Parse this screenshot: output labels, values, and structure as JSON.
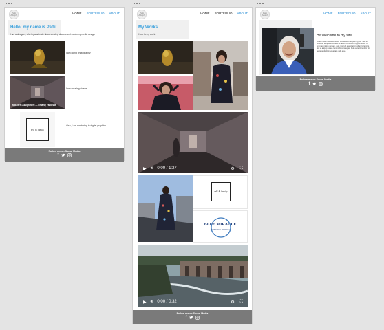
{
  "brand": {
    "logo_text": "Patti Adolph"
  },
  "nav": {
    "home": "HOME",
    "portfolio": "PORTFOLIO",
    "about": "ABOUT"
  },
  "footer": {
    "follow": "Follow me on Social Media"
  },
  "home": {
    "heading": "Hello! my name is Patti!",
    "intro": "I am a designer, who is passionate about creating dreams and mastering media design.",
    "captions": {
      "photo": "I am doing photography",
      "video": "I am creating videos",
      "graphic": "Also, I am mastering in digital graphics"
    },
    "video_overlay": "Mid-term Assignment — Rhianly Fabiosas",
    "graphic_logo": "self & family"
  },
  "works": {
    "heading": "My Works",
    "sub": "Here is my work",
    "video1_time": "0:00 / 1:27",
    "video2_time": "0:00 / 0:32",
    "logo1": "self & family",
    "logo2_top": "BLUE MIRACLE",
    "logo2_bottom": "CREATIVE DESIGN"
  },
  "about": {
    "heading": "Hi! Welcome to my site",
    "body": "Lorem ipsum dolor sit amet, consectetur adipiscing elit. Sed do eiusmod tempor incididunt ut labore et dolore magna aliqua. Ut enim ad minim veniam, quis nostrud exercitation ullamco laboris nisi ut aliquip ex ea commodo consequat. Duis aute irure dolor in reprehenderit in voluptate velit esse."
  }
}
